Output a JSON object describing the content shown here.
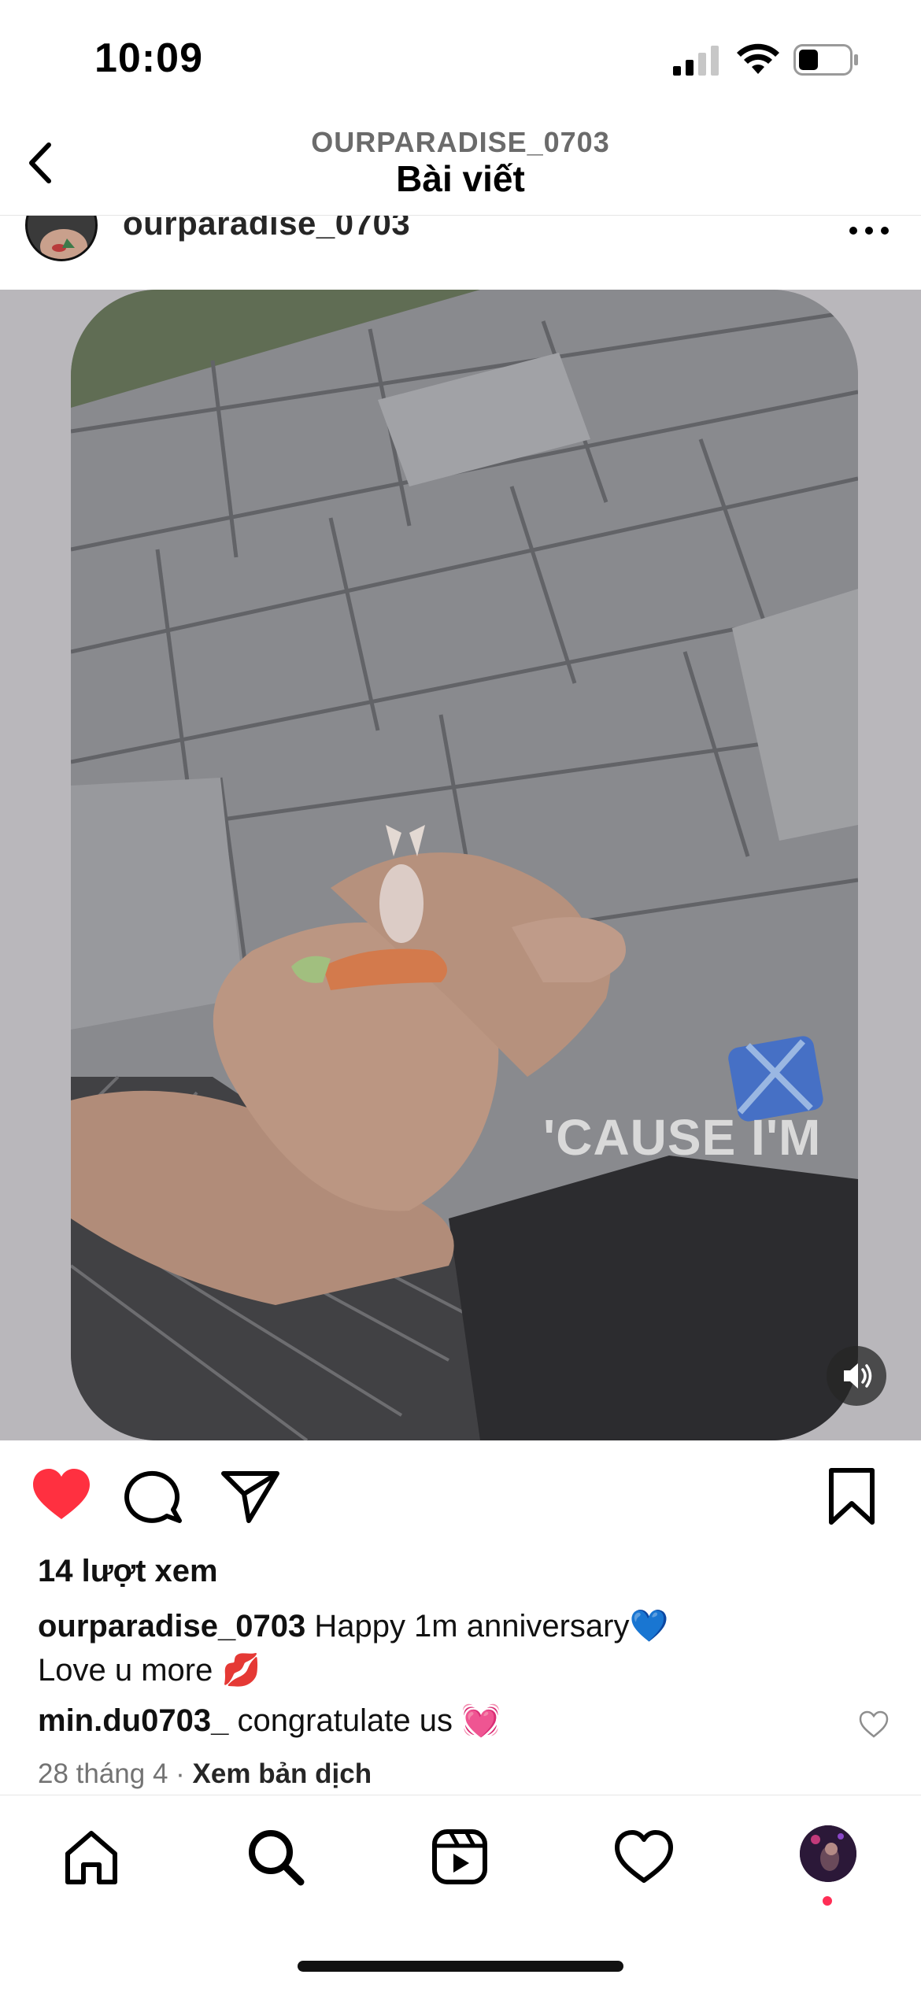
{
  "status_bar": {
    "time": "10:09"
  },
  "header": {
    "subtitle": "OURPARADISE_0703",
    "title": "Bài viết"
  },
  "post": {
    "author": "ourparadise_0703",
    "media_caption": "'CAUSE I'M",
    "views": "14 lượt xem",
    "caption_user": "ourparadise_0703",
    "caption_text_line1": " Happy 1m anniversary💙",
    "caption_text_line2": "Love u more 💋",
    "comment_user": "min.du0703_",
    "comment_text": " congratulate us 💓",
    "date": "28 tháng 4",
    "separator": " · ",
    "translate_label": "Xem bản dịch"
  },
  "colors": {
    "like_red": "#ff3040",
    "notification_dot": "#ff2d55"
  },
  "icons": {
    "back": "chevron-left-icon",
    "more": "more-horizontal-icon",
    "sound": "speaker-icon",
    "like": "heart-filled-icon",
    "comment": "comment-icon",
    "share": "send-icon",
    "save": "bookmark-icon",
    "home": "home-icon",
    "search": "search-icon",
    "reels": "reels-icon",
    "activity": "heart-icon"
  }
}
